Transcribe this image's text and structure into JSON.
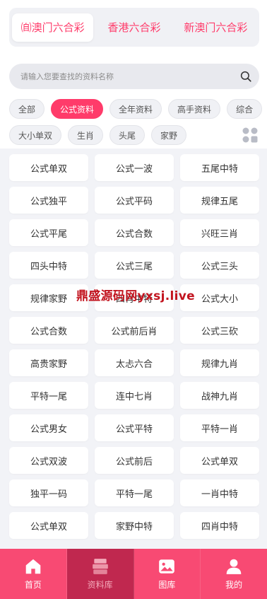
{
  "top_tabs": [
    {
      "prefix": "㉂",
      "label": "澳门六合彩",
      "active": true
    },
    {
      "label": "香港六合彩"
    },
    {
      "label": "新澳门六合彩"
    }
  ],
  "search": {
    "placeholder": "请输入您要查找的资料名称"
  },
  "chips_row1": [
    "全部",
    "公式资料",
    "全年资料",
    "高手资料",
    "综合"
  ],
  "chips_row2": [
    "大小单双",
    "生肖",
    "头尾",
    "家野"
  ],
  "active_chip": "公式资料",
  "grid_items": [
    "公式单双",
    "公式一波",
    "五尾中特",
    "公式独平",
    "公式平码",
    "规律五尾",
    "公式平尾",
    "公式合数",
    "兴旺三肖",
    "四头中特",
    "公式三尾",
    "公式三头",
    "规律家野",
    "四肖中特",
    "公式大小",
    "公式合数",
    "公式前后肖",
    "公式三砍",
    "高贵家野",
    "太忐六合",
    "规律九肖",
    "平特一尾",
    "连中七肖",
    "战神九肖",
    "公式男女",
    "公式平特",
    "平特一肖",
    "公式双波",
    "公式前后",
    "公式单双",
    "独平一码",
    "平特一尾",
    "一肖中特",
    "公式单双",
    "家野中特",
    "四肖中特"
  ],
  "watermark": "鼎盛源码网yxsj.live",
  "bottom_nav": [
    {
      "label": "首页",
      "icon": "home-icon"
    },
    {
      "label": "资料库",
      "icon": "database-icon",
      "active": true
    },
    {
      "label": "图库",
      "icon": "image-icon"
    },
    {
      "label": "我的",
      "icon": "user-icon"
    }
  ],
  "colors": {
    "accent": "#ff3b6a",
    "nav_bg": "#f84a73",
    "nav_active": "#c0284f"
  }
}
